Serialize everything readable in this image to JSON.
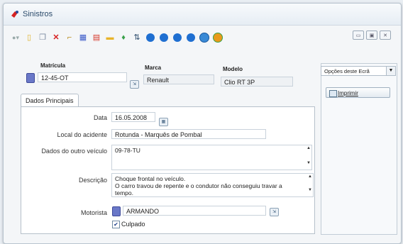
{
  "window": {
    "title": "Sinistros"
  },
  "header": {
    "matricula_label": "Matrícula",
    "matricula_value": "12-45-OT",
    "marca_label": "Marca",
    "marca_value": "Renault",
    "modelo_label": "Modelo",
    "modelo_value": "Clio RT 3P"
  },
  "side": {
    "options_select": "Opções deste Ecrã",
    "print_label": "Imprimir"
  },
  "tabs": [
    {
      "label": "Dados Principais"
    }
  ],
  "form": {
    "data_label": "Data",
    "data_value": "16.05.2008",
    "local_label": "Local do acidente",
    "local_value": "Rotunda - Marquês de Pombal",
    "outro_label": "Dados do outro veículo",
    "outro_value": "09-78-TU",
    "descricao_label": "Descrição",
    "descricao_line1": "Choque frontal no veículo.",
    "descricao_line2": "O carro travou de repente e o condutor não conseguiu travar a",
    "descricao_line3": "tempo.",
    "motorista_label": "Motorista",
    "motorista_value": "ARMANDO",
    "culpado_label": "Culpado",
    "culpado_checked": true
  },
  "toolbar_icons": [
    "new-record-icon",
    "new-document-icon",
    "copy-icon",
    "delete-icon",
    "edit-icon",
    "calculator-icon",
    "grid-icon",
    "folder-icon",
    "export-icon",
    "sort-icon",
    "first-record-icon",
    "previous-record-icon",
    "next-record-icon",
    "last-record-icon",
    "help-icon",
    "refresh-icon"
  ],
  "colors": {
    "accent": "#2a4a6a",
    "delete": "#d62222",
    "nav": "#1f6fd1"
  }
}
